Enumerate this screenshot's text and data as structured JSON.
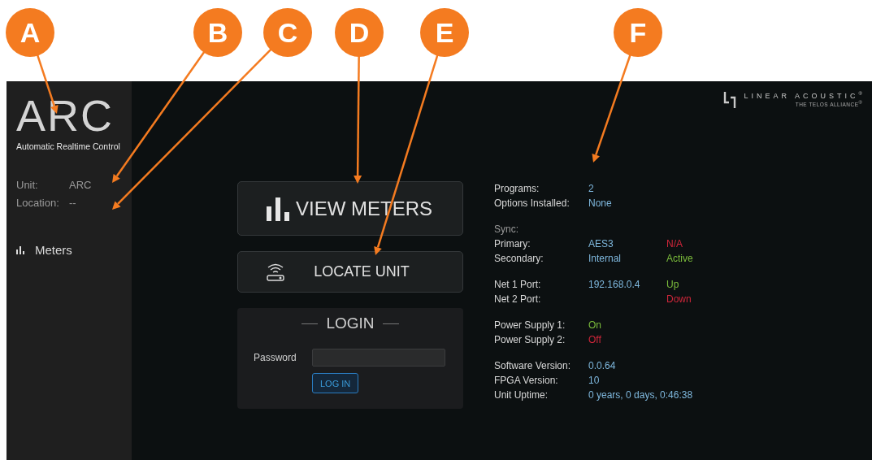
{
  "callouts": [
    {
      "letter": "A"
    },
    {
      "letter": "B"
    },
    {
      "letter": "C"
    },
    {
      "letter": "D"
    },
    {
      "letter": "E"
    },
    {
      "letter": "F"
    }
  ],
  "sidebar": {
    "logo": {
      "mark": "ARC",
      "subtitle": "Automatic Realtime Control"
    },
    "fields": [
      {
        "label": "Unit:",
        "value": "ARC"
      },
      {
        "label": "Location:",
        "value": "--"
      }
    ],
    "nav": [
      {
        "label": "Meters"
      }
    ]
  },
  "brand": {
    "name": "LINEAR ACOUSTIC$^{®}$",
    "tagline": "THE TELOS ALLIANCE$^{®}$"
  },
  "actions": [
    {
      "label": "VIEW METERS",
      "kind": "meters"
    },
    {
      "label": "LOCATE UNIT",
      "kind": "locate"
    }
  ],
  "login": {
    "title": "LOGIN",
    "password_label": "Password",
    "button": "LOG IN"
  },
  "status": [
    {
      "rows": [
        {
          "label": "Programs:",
          "value": {
            "text": "2",
            "color": "#7fb8de"
          }
        },
        {
          "label": "Options Installed:",
          "value": {
            "text": "None",
            "color": "#7fb8de"
          }
        }
      ]
    },
    {
      "heading": "Sync:",
      "rows": [
        {
          "label": "Primary:",
          "value": {
            "text": "AES3",
            "color": "#7fb8de"
          },
          "state": {
            "text": "N/A",
            "color": "#d0263a"
          }
        },
        {
          "label": "Secondary:",
          "value": {
            "text": "Internal",
            "color": "#7fb8de"
          },
          "state": {
            "text": "Active",
            "color": "#7cbd3c"
          }
        }
      ]
    },
    {
      "rows": [
        {
          "label": "Net 1 Port:",
          "value": {
            "text": "192.168.0.4",
            "color": "#7fb8de"
          },
          "state": {
            "text": "Up",
            "color": "#7cbd3c"
          }
        },
        {
          "label": "Net 2 Port:",
          "state": {
            "text": "Down",
            "color": "#d0263a"
          }
        }
      ]
    },
    {
      "rows": [
        {
          "label": "Power Supply 1:",
          "value": {
            "text": "On",
            "color": "#7cbd3c"
          }
        },
        {
          "label": "Power Supply 2:",
          "value": {
            "text": "Off",
            "color": "#d0263a"
          }
        }
      ]
    },
    {
      "rows": [
        {
          "label": "Software Version:",
          "value": {
            "text": "0.0.64",
            "color": "#7fb8de"
          }
        },
        {
          "label": "FPGA Version:",
          "value": {
            "text": "10",
            "color": "#7fb8de"
          }
        },
        {
          "label": "Unit Uptime:",
          "value": {
            "text": "0 years, 0 days, 0:46:38",
            "color": "#7fb8de"
          }
        }
      ]
    }
  ]
}
